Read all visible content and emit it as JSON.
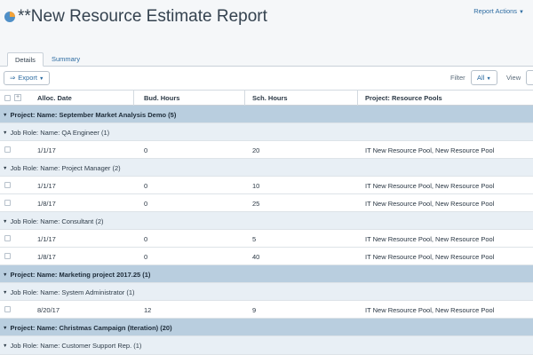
{
  "header": {
    "title": "**New Resource Estimate Report",
    "report_actions": "Report Actions"
  },
  "tabs": [
    {
      "label": "Details",
      "active": true
    },
    {
      "label": "Summary",
      "active": false
    }
  ],
  "toolbar": {
    "export_label": "Export",
    "filter_label": "Filter",
    "filter_value": "All",
    "view_label": "View"
  },
  "columns": {
    "date": "Alloc. Date",
    "bud": "Bud. Hours",
    "sch": "Sch. Hours",
    "pool": "Project: Resource Pools"
  },
  "rows": [
    {
      "type": "project",
      "label": "Project: Name: September Market Analysis Demo (5)"
    },
    {
      "type": "jobrole",
      "label": "Job Role: Name: QA Engineer (1)"
    },
    {
      "type": "data",
      "date": "1/1/17",
      "bud": "0",
      "sch": "20",
      "pool": "IT New Resource Pool, New Resource Pool"
    },
    {
      "type": "jobrole",
      "label": "Job Role: Name: Project Manager (2)"
    },
    {
      "type": "data",
      "date": "1/1/17",
      "bud": "0",
      "sch": "10",
      "pool": "IT New Resource Pool, New Resource Pool"
    },
    {
      "type": "data",
      "date": "1/8/17",
      "bud": "0",
      "sch": "25",
      "pool": "IT New Resource Pool, New Resource Pool"
    },
    {
      "type": "jobrole",
      "label": "Job Role: Name: Consultant (2)"
    },
    {
      "type": "data",
      "date": "1/1/17",
      "bud": "0",
      "sch": "5",
      "pool": "IT New Resource Pool, New Resource Pool"
    },
    {
      "type": "data",
      "date": "1/8/17",
      "bud": "0",
      "sch": "40",
      "pool": "IT New Resource Pool, New Resource Pool"
    },
    {
      "type": "project",
      "label": "Project: Name: Marketing project 2017.25 (1)"
    },
    {
      "type": "jobrole",
      "label": "Job Role: Name: System Administrator (1)"
    },
    {
      "type": "data",
      "date": "8/20/17",
      "bud": "12",
      "sch": "9",
      "pool": "IT New Resource Pool, New Resource Pool"
    },
    {
      "type": "project",
      "label": "Project: Name: Christmas Campaign (Iteration) (20)"
    },
    {
      "type": "jobrole",
      "label": "Job Role: Name: Customer Support Rep. (1)"
    }
  ]
}
